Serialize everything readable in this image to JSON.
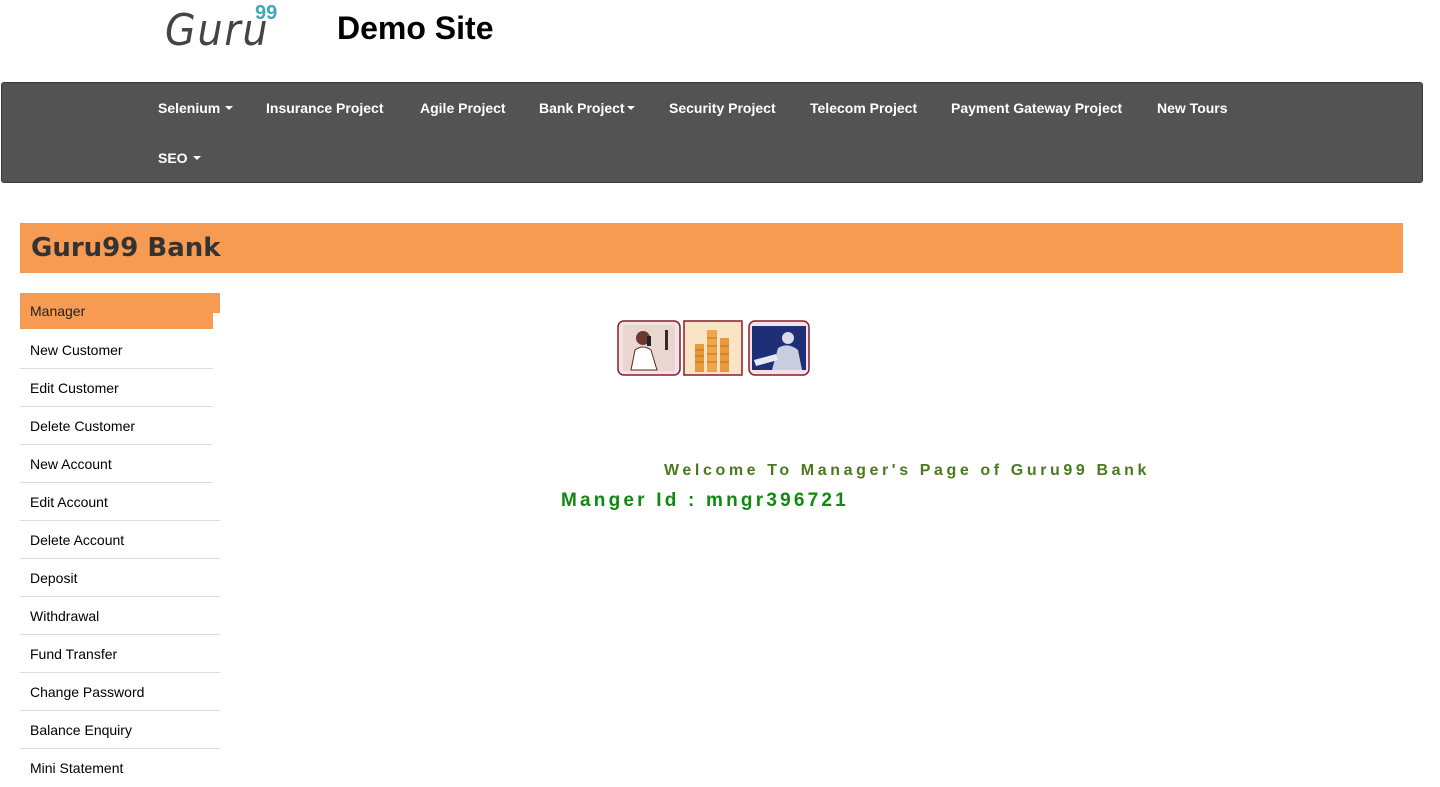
{
  "header": {
    "logo_text": "Guru",
    "logo_superscript": "99",
    "site_title": "Demo Site"
  },
  "navbar": {
    "items": [
      {
        "label": "Selenium",
        "dropdown": true
      },
      {
        "label": "Insurance Project",
        "dropdown": false
      },
      {
        "label": "Agile Project",
        "dropdown": false
      },
      {
        "label": "Bank Project",
        "dropdown": true
      },
      {
        "label": "Security Project",
        "dropdown": false
      },
      {
        "label": "Telecom Project",
        "dropdown": false
      },
      {
        "label": "Payment Gateway Project",
        "dropdown": false
      },
      {
        "label": "New Tours",
        "dropdown": false
      },
      {
        "label": "SEO",
        "dropdown": true
      }
    ],
    "background": "#535353"
  },
  "banner": {
    "title": "Guru99 Bank",
    "color": "#f79a52"
  },
  "sidebar": {
    "heading": "Manager",
    "items": [
      {
        "label": "New Customer"
      },
      {
        "label": "Edit Customer"
      },
      {
        "label": "Delete Customer"
      },
      {
        "label": "New Account"
      },
      {
        "label": "Edit Account"
      },
      {
        "label": "Delete Account"
      },
      {
        "label": "Deposit"
      },
      {
        "label": "Withdrawal"
      },
      {
        "label": "Fund Transfer"
      },
      {
        "label": "Change Password"
      },
      {
        "label": "Balance Enquiry"
      },
      {
        "label": "Mini Statement"
      }
    ]
  },
  "main": {
    "welcome": "Welcome To Manager's Page of Guru99 Bank",
    "manager_id": "Manger Id : mngr396721",
    "welcome_color": "#4b7a1e",
    "manager_id_color": "#118811"
  }
}
